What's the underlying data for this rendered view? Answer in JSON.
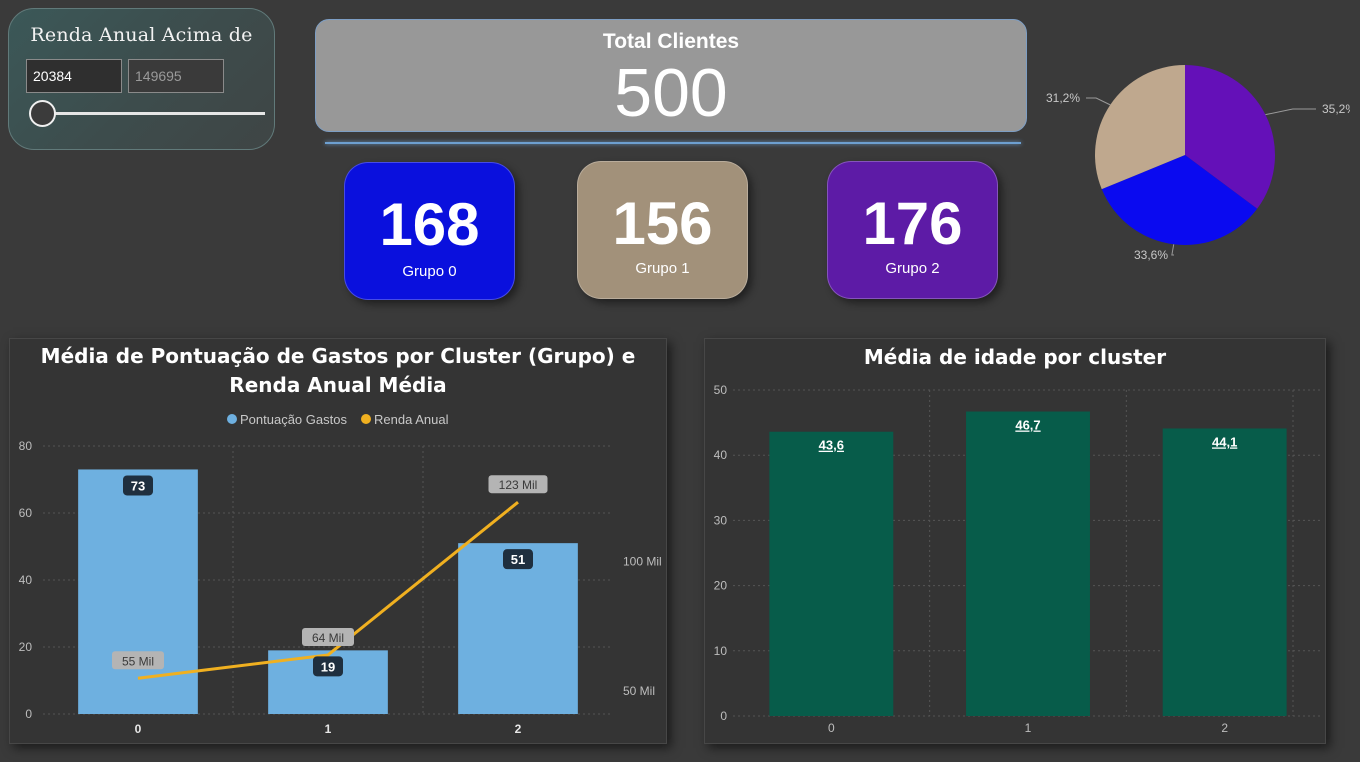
{
  "slicer": {
    "title": "Renda Anual Acima de",
    "min_value": "20384",
    "max_value": "149695",
    "slider_level": 0
  },
  "total": {
    "label": "Total Clientes",
    "value": "500"
  },
  "groups": [
    {
      "value": "168",
      "label": "Grupo 0",
      "color": "#0a10dd"
    },
    {
      "value": "156",
      "label": "Grupo 1",
      "color": "#a2917a"
    },
    {
      "value": "176",
      "label": "Grupo 2",
      "color": "#5d1ba6"
    }
  ],
  "pie": {
    "chart_data": {
      "type": "pie",
      "slices": [
        {
          "label": "35,2%",
          "value": 35.2,
          "color": "#6410b8"
        },
        {
          "label": "33,6%",
          "value": 33.6,
          "color": "#0a0af0"
        },
        {
          "label": "31,2%",
          "value": 31.2,
          "color": "#bfa88e"
        }
      ]
    }
  },
  "chart_data": [
    {
      "type": "bar",
      "title": "Média de Pontuação de Gastos por Cluster (Grupo) e Renda Anual Média",
      "legend": [
        "Pontuação Gastos",
        "Renda Anual"
      ],
      "legend_position": "top",
      "categories": [
        "0",
        "1",
        "2"
      ],
      "series": [
        {
          "name": "Pontuação Gastos",
          "type": "bar",
          "values": [
            73,
            19,
            51
          ],
          "labels": [
            "73",
            "19",
            "51"
          ],
          "color": "#6eb0e0"
        },
        {
          "name": "Renda Anual",
          "type": "line",
          "values": [
            55,
            64,
            123
          ],
          "labels": [
            "55 Mil",
            "64 Mil",
            "123 Mil"
          ],
          "color": "#f0b020"
        }
      ],
      "y_ticks": [
        "0",
        "20",
        "40",
        "60",
        "80"
      ],
      "ylim": [
        0,
        80
      ],
      "y2_ticks": [
        "50 Mil",
        "100 Mil"
      ],
      "y2lim": [
        41.2,
        144.7
      ],
      "grid": true
    },
    {
      "type": "bar",
      "title": "Média de idade por cluster",
      "categories": [
        "0",
        "1",
        "2"
      ],
      "values": [
        43.6,
        46.7,
        44.1
      ],
      "labels": [
        "43,6",
        "46,7",
        "44,1"
      ],
      "color": "#075c4a",
      "y_ticks": [
        "0",
        "10",
        "20",
        "30",
        "40",
        "50"
      ],
      "ylim": [
        0,
        50
      ],
      "grid": true
    }
  ]
}
